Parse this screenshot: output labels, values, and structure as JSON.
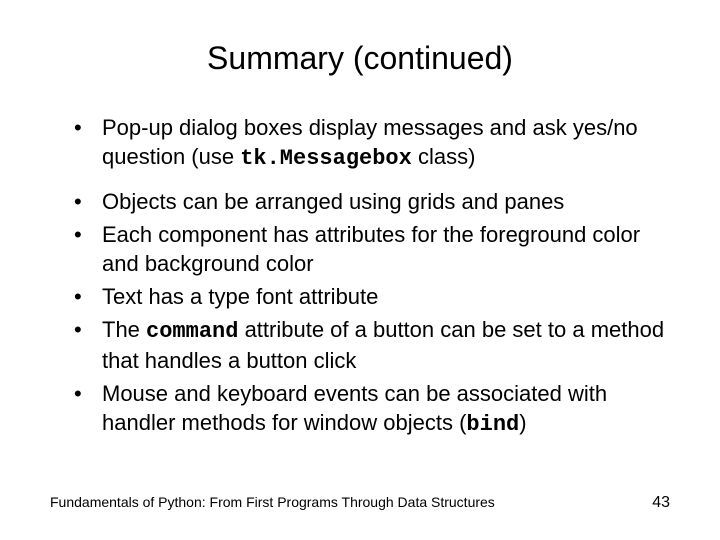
{
  "title": "Summary (continued)",
  "bullets": {
    "b1a": "Pop-up dialog boxes display messages and ask yes/no question (use ",
    "b1code": "tk.Messagebox",
    "b1b": " class)",
    "b2": "Objects can be arranged using grids and panes",
    "b3": "Each component has attributes for the foreground color and background color",
    "b4": "Text has a type font attribute",
    "b5a": "The ",
    "b5code": "command",
    "b5b": " attribute of a button can be set to a method that handles a button click",
    "b6a": "Mouse and keyboard events can be associated with handler methods for window objects (",
    "b6code": "bind",
    "b6b": ")"
  },
  "footer": {
    "text": "Fundamentals of Python: From First Programs Through Data Structures",
    "page": "43"
  }
}
